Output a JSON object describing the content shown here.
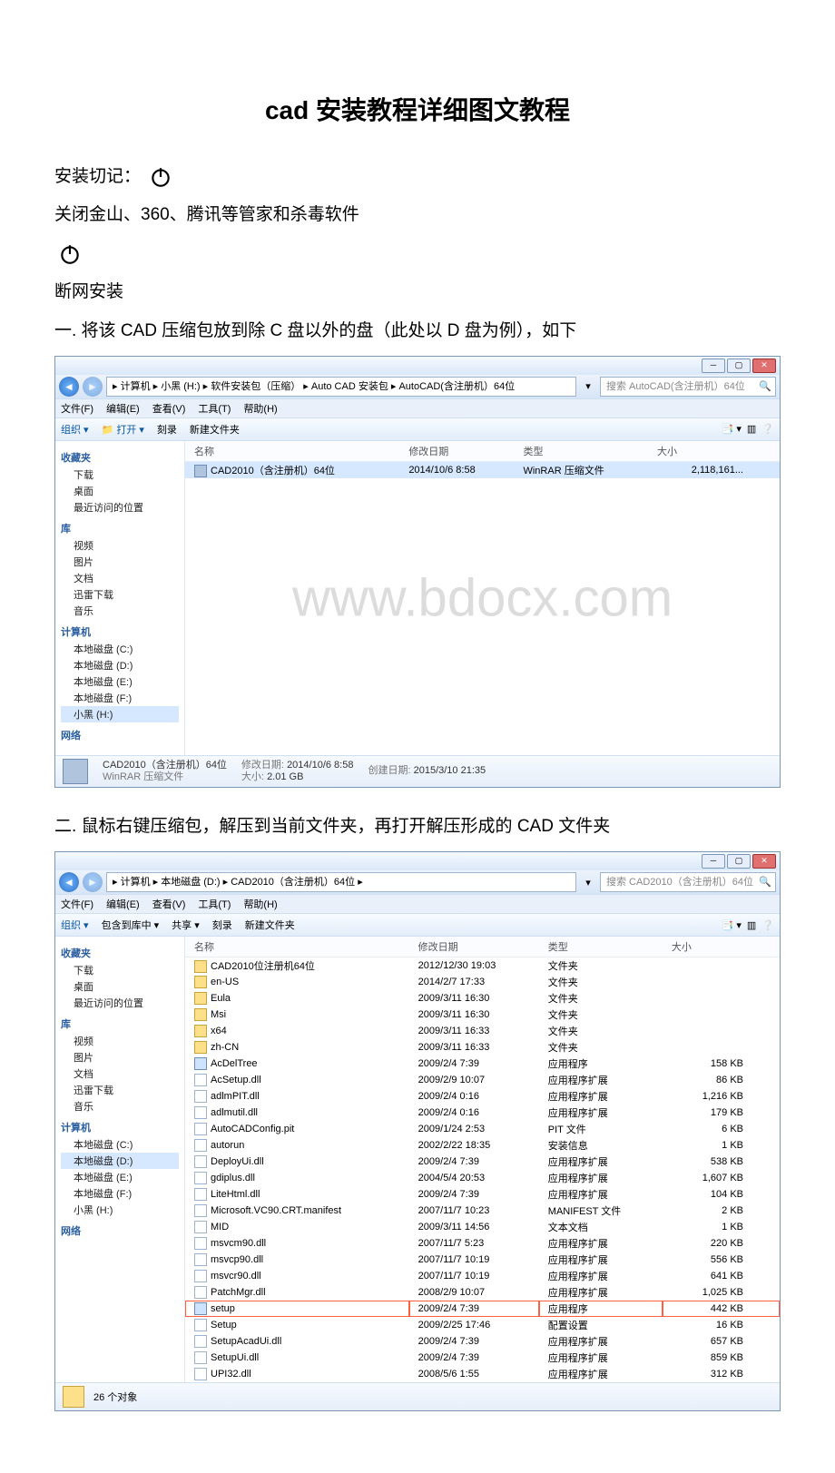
{
  "doc": {
    "title": "cad 安装教程详细图文教程",
    "line1_prefix": "安装切记：",
    "line2": "关闭金山、360、腾讯等管家和杀毒软件",
    "line3": "断网安装",
    "step1": "一. 将该 CAD 压缩包放到除 C 盘以外的盘（此处以 D 盘为例），如下",
    "step2": "二. 鼠标右键压缩包，解压到当前文件夹，再打开解压形成的 CAD 文件夹",
    "watermark": "www.bdocx.com"
  },
  "win1": {
    "breadcrumbs": "▸ 计算机 ▸ 小黑 (H:) ▸ 软件安装包（压缩） ▸ Auto CAD 安装包 ▸ AutoCAD(含注册机）64位",
    "search": "搜索 AutoCAD(含注册机）64位",
    "menu": [
      "文件(F)",
      "编辑(E)",
      "查看(V)",
      "工具(T)",
      "帮助(H)"
    ],
    "cmd": {
      "org": "组织 ▾",
      "open": "📁 打开 ▾",
      "del": "刻录",
      "new": "新建文件夹"
    },
    "cols": [
      "名称",
      "修改日期",
      "类型",
      "大小"
    ],
    "rows": [
      {
        "name": "CAD2010（含注册机）64位",
        "date": "2014/10/6 8:58",
        "type": "WinRAR 压缩文件",
        "size": "2,118,161...",
        "icon": "archive",
        "sel": true
      }
    ],
    "nav": {
      "fav": {
        "hdr": "收藏夹",
        "items": [
          "下载",
          "桌面",
          "最近访问的位置"
        ]
      },
      "lib": {
        "hdr": "库",
        "items": [
          "视频",
          "图片",
          "文档",
          "迅雷下载",
          "音乐"
        ]
      },
      "pc": {
        "hdr": "计算机",
        "items": [
          "本地磁盘 (C:)",
          "本地磁盘 (D:)",
          "本地磁盘 (E:)",
          "本地磁盘 (F:)",
          "小黑 (H:)"
        ]
      },
      "net": {
        "hdr": "网络"
      }
    },
    "status": {
      "name": "CAD2010（含注册机）64位",
      "sub": "WinRAR 压缩文件",
      "mod_l": "修改日期:",
      "mod": "2014/10/6 8:58",
      "size_l": "大小:",
      "size": "2.01 GB",
      "created_l": "创建日期:",
      "created": "2015/3/10 21:35"
    }
  },
  "win2": {
    "breadcrumbs": "▸ 计算机 ▸ 本地磁盘 (D:) ▸ CAD2010（含注册机）64位 ▸",
    "search": "搜索 CAD2010（含注册机）64位",
    "menu": [
      "文件(F)",
      "编辑(E)",
      "查看(V)",
      "工具(T)",
      "帮助(H)"
    ],
    "cmd": {
      "org": "组织 ▾",
      "inc": "包含到库中 ▾",
      "share": "共享 ▾",
      "del": "刻录",
      "new": "新建文件夹"
    },
    "cols": [
      "名称",
      "修改日期",
      "类型",
      "大小"
    ],
    "rows": [
      {
        "name": "CAD2010位注册机64位",
        "date": "2012/12/30 19:03",
        "type": "文件夹",
        "size": "",
        "icon": "folder"
      },
      {
        "name": "en-US",
        "date": "2014/2/7 17:33",
        "type": "文件夹",
        "size": "",
        "icon": "folder"
      },
      {
        "name": "Eula",
        "date": "2009/3/11 16:30",
        "type": "文件夹",
        "size": "",
        "icon": "folder"
      },
      {
        "name": "Msi",
        "date": "2009/3/11 16:30",
        "type": "文件夹",
        "size": "",
        "icon": "folder"
      },
      {
        "name": "x64",
        "date": "2009/3/11 16:33",
        "type": "文件夹",
        "size": "",
        "icon": "folder"
      },
      {
        "name": "zh-CN",
        "date": "2009/3/11 16:33",
        "type": "文件夹",
        "size": "",
        "icon": "folder"
      },
      {
        "name": "AcDelTree",
        "date": "2009/2/4 7:39",
        "type": "应用程序",
        "size": "158 KB",
        "icon": "app"
      },
      {
        "name": "AcSetup.dll",
        "date": "2009/2/9 10:07",
        "type": "应用程序扩展",
        "size": "86 KB",
        "icon": "file"
      },
      {
        "name": "adlmPIT.dll",
        "date": "2009/2/4 0:16",
        "type": "应用程序扩展",
        "size": "1,216 KB",
        "icon": "file"
      },
      {
        "name": "adlmutil.dll",
        "date": "2009/2/4 0:16",
        "type": "应用程序扩展",
        "size": "179 KB",
        "icon": "file"
      },
      {
        "name": "AutoCADConfig.pit",
        "date": "2009/1/24 2:53",
        "type": "PIT 文件",
        "size": "6 KB",
        "icon": "file"
      },
      {
        "name": "autorun",
        "date": "2002/2/22 18:35",
        "type": "安装信息",
        "size": "1 KB",
        "icon": "file"
      },
      {
        "name": "DeployUi.dll",
        "date": "2009/2/4 7:39",
        "type": "应用程序扩展",
        "size": "538 KB",
        "icon": "file"
      },
      {
        "name": "gdiplus.dll",
        "date": "2004/5/4 20:53",
        "type": "应用程序扩展",
        "size": "1,607 KB",
        "icon": "file"
      },
      {
        "name": "LiteHtml.dll",
        "date": "2009/2/4 7:39",
        "type": "应用程序扩展",
        "size": "104 KB",
        "icon": "file"
      },
      {
        "name": "Microsoft.VC90.CRT.manifest",
        "date": "2007/11/7 10:23",
        "type": "MANIFEST 文件",
        "size": "2 KB",
        "icon": "file"
      },
      {
        "name": "MID",
        "date": "2009/3/11 14:56",
        "type": "文本文档",
        "size": "1 KB",
        "icon": "file"
      },
      {
        "name": "msvcm90.dll",
        "date": "2007/11/7 5:23",
        "type": "应用程序扩展",
        "size": "220 KB",
        "icon": "file"
      },
      {
        "name": "msvcp90.dll",
        "date": "2007/11/7 10:19",
        "type": "应用程序扩展",
        "size": "556 KB",
        "icon": "file"
      },
      {
        "name": "msvcr90.dll",
        "date": "2007/11/7 10:19",
        "type": "应用程序扩展",
        "size": "641 KB",
        "icon": "file"
      },
      {
        "name": "PatchMgr.dll",
        "date": "2008/2/9 10:07",
        "type": "应用程序扩展",
        "size": "1,025 KB",
        "icon": "file"
      },
      {
        "name": "setup",
        "date": "2009/2/4 7:39",
        "type": "应用程序",
        "size": "442 KB",
        "icon": "app",
        "hl": true
      },
      {
        "name": "Setup",
        "date": "2009/2/25 17:46",
        "type": "配置设置",
        "size": "16 KB",
        "icon": "file"
      },
      {
        "name": "SetupAcadUi.dll",
        "date": "2009/2/4 7:39",
        "type": "应用程序扩展",
        "size": "657 KB",
        "icon": "file"
      },
      {
        "name": "SetupUi.dll",
        "date": "2009/2/4 7:39",
        "type": "应用程序扩展",
        "size": "859 KB",
        "icon": "file"
      },
      {
        "name": "UPI32.dll",
        "date": "2008/5/6 1:55",
        "type": "应用程序扩展",
        "size": "312 KB",
        "icon": "file"
      }
    ],
    "nav": {
      "fav": {
        "hdr": "收藏夹",
        "items": [
          "下载",
          "桌面",
          "最近访问的位置"
        ]
      },
      "lib": {
        "hdr": "库",
        "items": [
          "视频",
          "图片",
          "文档",
          "迅雷下载",
          "音乐"
        ]
      },
      "pc": {
        "hdr": "计算机",
        "items": [
          "本地磁盘 (C:)",
          "本地磁盘 (D:)",
          "本地磁盘 (E:)",
          "本地磁盘 (F:)",
          "小黑 (H:)"
        ]
      },
      "net": {
        "hdr": "网络"
      }
    },
    "status": {
      "count": "26 个对象"
    }
  }
}
